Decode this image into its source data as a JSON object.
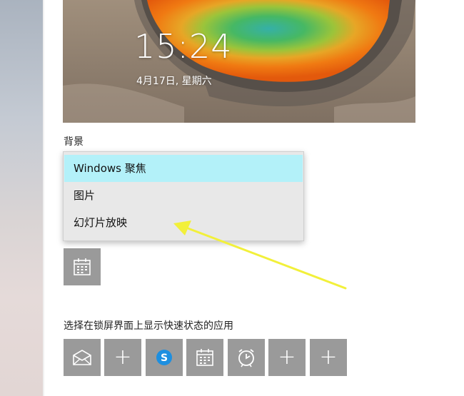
{
  "preview": {
    "time": "15:24",
    "date": "4月17日, 星期六"
  },
  "background": {
    "label": "背景",
    "options": [
      {
        "label": "Windows 聚焦",
        "selected": true
      },
      {
        "label": "图片",
        "selected": false
      },
      {
        "label": "幻灯片放映",
        "selected": false
      }
    ]
  },
  "quick_status": {
    "label": "选择在锁屏界面上显示快速状态的应用",
    "tiles": [
      {
        "icon": "mail-icon"
      },
      {
        "icon": "plus-icon"
      },
      {
        "icon": "skype-icon"
      },
      {
        "icon": "calendar-icon"
      },
      {
        "icon": "alarm-clock-icon"
      },
      {
        "icon": "plus-icon"
      },
      {
        "icon": "plus-icon"
      }
    ]
  },
  "detailed_status_tile": {
    "icon": "calendar-icon"
  },
  "colors": {
    "selected_option": "#b3f1f9",
    "tile": "#9a9a9a",
    "annotation_arrow": "#f2f03a"
  }
}
